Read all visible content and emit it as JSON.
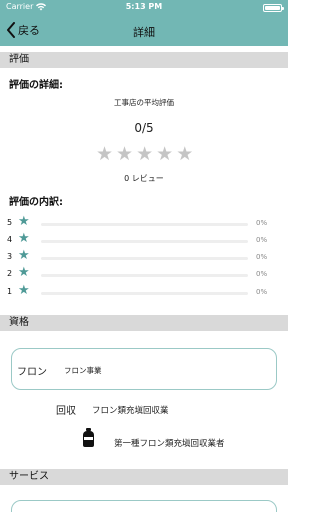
{
  "status_bar": {
    "carrier": "Carrier",
    "time": "5:13 PM"
  },
  "nav": {
    "back_label": "戻る",
    "title": "詳細"
  },
  "rating_section": {
    "header": "評価",
    "details_label": "評価の詳細:",
    "average_label": "工事店の平均評価",
    "average_score": "0/5",
    "star_count": 5,
    "filled_stars": 0,
    "review_count": "0 レビュー",
    "breakdown_label": "評価の内訳:",
    "breakdown": [
      {
        "stars": "5",
        "percent": "0%",
        "fraction": 0
      },
      {
        "stars": "4",
        "percent": "0%",
        "fraction": 0
      },
      {
        "stars": "3",
        "percent": "0%",
        "fraction": 0
      },
      {
        "stars": "2",
        "percent": "0%",
        "fraction": 0
      },
      {
        "stars": "1",
        "percent": "0%",
        "fraction": 0
      }
    ]
  },
  "qualifications_section": {
    "header": "資格",
    "card": {
      "tag": "フロン",
      "name": "フロン事業"
    },
    "items": [
      {
        "tag": "回収",
        "name": "フロン類充塡回収業"
      },
      {
        "icon": "gas-cylinder-icon",
        "name": "第一種フロン類充塡回収業者"
      }
    ]
  },
  "services_section": {
    "header": "サービス"
  },
  "colors": {
    "accent": "#72b7b4",
    "star_accent": "#4f9a97",
    "section_bg": "#d9d9d9",
    "card_border": "#9bc9c6"
  }
}
